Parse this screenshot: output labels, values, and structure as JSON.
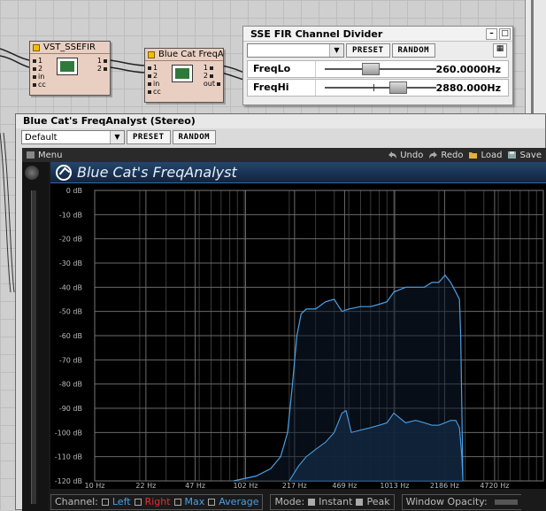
{
  "modules": {
    "vst": {
      "title": "VST_SSEFIR",
      "inputs": [
        "1",
        "2",
        "in",
        "cc"
      ],
      "outputs": [
        "1",
        "2"
      ]
    },
    "bluecat": {
      "title": "Blue Cat FreqAn",
      "inputs": [
        "1",
        "2",
        "in",
        "cc"
      ],
      "outputs": [
        "1",
        "2",
        "out"
      ]
    }
  },
  "fir": {
    "title": "SSE FIR Channel Divider",
    "preset_label": "PRESET",
    "random_label": "RANDOM",
    "params": [
      {
        "name": "FreqLo",
        "value": "260.0000Hz",
        "level": 0.38
      },
      {
        "name": "FreqHi",
        "value": "2880.000Hz",
        "level": 0.66
      }
    ]
  },
  "fa": {
    "title": "Blue Cat's FreqAnalyst (Stereo)",
    "preset_value": "Default",
    "preset_label": "PRESET",
    "random_label": "RANDOM",
    "menu": {
      "menu": "Menu",
      "undo": "Undo",
      "redo": "Redo",
      "load": "Load",
      "save": "Save"
    },
    "header_title": "Blue Cat's FreqAnalyst",
    "legend": {
      "channel_label": "Channel:",
      "left": "Left",
      "right": "Right",
      "max": "Max",
      "average": "Average",
      "mode_label": "Mode:",
      "instant": "Instant",
      "peak": "Peak",
      "opacity_label": "Window Opacity:"
    },
    "colors": {
      "left": "#4aa0e8",
      "right": "#e03030",
      "max": "#4aa0e8",
      "average": "#4aa0e8"
    }
  },
  "chart_data": {
    "type": "line",
    "x_scale": "log",
    "xlim": [
      10,
      10000
    ],
    "ylim": [
      -120,
      0
    ],
    "x_ticks": [
      {
        "v": 10,
        "label": "10 Hz"
      },
      {
        "v": 22,
        "label": "22 Hz"
      },
      {
        "v": 47,
        "label": "47 Hz"
      },
      {
        "v": 102,
        "label": "102 Hz"
      },
      {
        "v": 217,
        "label": "217 Hz"
      },
      {
        "v": 469,
        "label": "469 Hz"
      },
      {
        "v": 1013,
        "label": "1013 Hz"
      },
      {
        "v": 2186,
        "label": "2186 Hz"
      },
      {
        "v": 4720,
        "label": "4720 Hz"
      }
    ],
    "y_ticks": [
      {
        "v": 0,
        "label": "0 dB"
      },
      {
        "v": -10,
        "label": "-10 dB"
      },
      {
        "v": -20,
        "label": "-20 dB"
      },
      {
        "v": -30,
        "label": "-30 dB"
      },
      {
        "v": -40,
        "label": "-40 dB"
      },
      {
        "v": -50,
        "label": "-50 dB"
      },
      {
        "v": -60,
        "label": "-60 dB"
      },
      {
        "v": -70,
        "label": "-70 dB"
      },
      {
        "v": -80,
        "label": "-80 dB"
      },
      {
        "v": -90,
        "label": "-90 dB"
      },
      {
        "v": -100,
        "label": "-100 dB"
      },
      {
        "v": -110,
        "label": "-110 dB"
      },
      {
        "v": -120,
        "label": "-120 dB"
      }
    ],
    "grid": true,
    "series": [
      {
        "role": "max",
        "x": [
          85,
          120,
          150,
          175,
          195,
          210,
          225,
          240,
          260,
          300,
          350,
          400,
          450,
          500,
          600,
          700,
          800,
          900,
          1000,
          1200,
          1400,
          1600,
          1800,
          2000,
          2200,
          2400,
          2600,
          2750,
          2800,
          2850,
          2900
        ],
        "y": [
          -120,
          -118,
          -115,
          -110,
          -100,
          -80,
          -60,
          -51,
          -49,
          -49,
          -46,
          -45,
          -50,
          -49,
          -48,
          -48,
          -47,
          -46,
          -42,
          -40,
          -40,
          -40,
          -38,
          -38,
          -35,
          -38,
          -42,
          -45,
          -60,
          -90,
          -120
        ]
      },
      {
        "role": "average",
        "x": [
          200,
          230,
          260,
          300,
          350,
          400,
          450,
          480,
          520,
          600,
          700,
          800,
          900,
          1000,
          1200,
          1400,
          1600,
          1800,
          2000,
          2200,
          2400,
          2600,
          2750,
          2850,
          2900
        ],
        "y": [
          -120,
          -114,
          -110,
          -107,
          -104,
          -100,
          -92,
          -91,
          -100,
          -99,
          -98,
          -97,
          -96,
          -92,
          -96,
          -95,
          -96,
          -97,
          -97,
          -96,
          -95,
          -95,
          -98,
          -110,
          -120
        ]
      }
    ]
  }
}
